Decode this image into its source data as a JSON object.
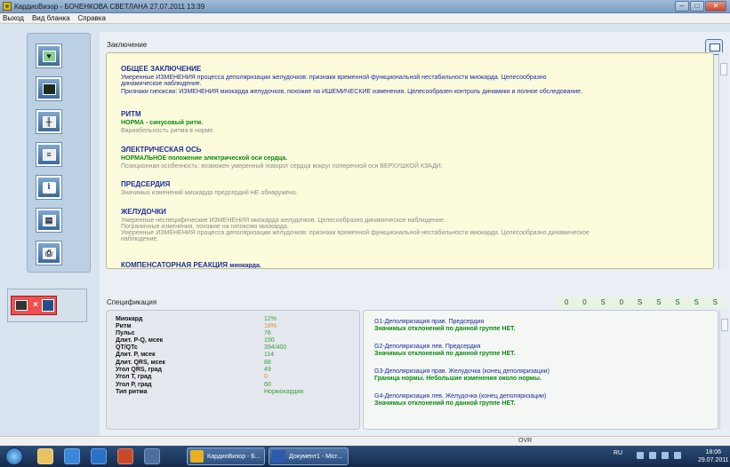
{
  "window": {
    "title": "КардиоВизор - БОЧЕНКОВА  СВЕТЛАНА   27.07.2011  13:39",
    "min_glyph": "–",
    "max_glyph": "□",
    "close_glyph": "✕"
  },
  "menu": [
    "Выход",
    "Вид бланка",
    "Справка"
  ],
  "left_toolbar": {
    "buttons": [
      {
        "icon": "heart-monitor-icon",
        "glyph": "♥"
      },
      {
        "icon": "dark-screen-icon",
        "glyph": ""
      },
      {
        "icon": "ecg-graph-icon",
        "glyph": "╫"
      },
      {
        "icon": "ecg-sheet-icon",
        "glyph": "≡"
      },
      {
        "icon": "info-icon",
        "glyph": "i"
      },
      {
        "icon": "print-stack-icon",
        "glyph": "▤"
      },
      {
        "icon": "printer-icon",
        "glyph": "⎙"
      }
    ]
  },
  "conclusion": {
    "header": "Заключение",
    "general": {
      "title": "ОБЩЕЕ ЗАКЛЮЧЕНИЕ",
      "line1": "Умеренные ИЗМЕНЕНИЯ процесса  деполяризации желудочков:  признаки  временной функциональной нестабильности миокарда.  Целесообразно",
      "line2": "динамическое наблюдение.",
      "line3": "Признаки гипоксии: ИЗМЕНЕНИЯ миокарда желудочков, похожие на ИШЕМИЧЕСКИЕ изменения. Целесообразен контроль динамики и полное обследование."
    },
    "rhythm": {
      "title": "РИТМ",
      "status": "НОРМА - синусовый ритм.",
      "detail": "Вариабельность ритма в норме."
    },
    "axis": {
      "title": "ЭЛЕКТРИЧЕСКАЯ ОСЬ",
      "status": "НОРМАЛЬНОЕ положение электрической оси сердца.",
      "detail": "Позиционная особенность: возможен умеренный поворот сердца вокруг поперечной оси ВЕРХУШКОЙ КЗАДИ."
    },
    "atria": {
      "title": "ПРЕДСЕРДИЯ",
      "detail": "Значимых  изменений  миокарда предсердий НЕ обнаружено."
    },
    "ventricles": {
      "title": "ЖЕЛУДОЧКИ",
      "line1": "Умеренные неспецифические ИЗМЕНЕНИЯ миокарда желудочков. Целесообразно динамическое наблюдение.",
      "line2": "Пограничные изменения, похожие на гипоксию миокарда.",
      "line3": "Умеренные ИЗМЕНЕНИЯ процесса  деполяризации желудочков:  признаки  временной  функциональной нестабильности миокарда.  Целесообразно  динамическое",
      "line4": "наблюдение."
    },
    "compensatory": {
      "title": "КОМПЕНСАТОРНАЯ РЕАКЦИЯ",
      "suffix": "миокарда."
    }
  },
  "specification": {
    "header": "Спецификация",
    "codes": [
      "0",
      "0",
      "S",
      "0",
      "S",
      "S",
      "S",
      "S",
      "S"
    ],
    "parameters": [
      {
        "label": "Миокард",
        "value": "12%",
        "color": "#3aa03a"
      },
      {
        "label": "Ритм",
        "value": "18%",
        "color": "#d99030"
      },
      {
        "label": "Пульс",
        "value": "76",
        "color": "#3aa03a"
      },
      {
        "label": "Длит. P-Q, мсек",
        "value": "150",
        "color": "#3aa03a"
      },
      {
        "label": "QT/QTc",
        "value": "394/400",
        "color": "#3aa03a"
      },
      {
        "label": "Длит. P, мсек",
        "value": "114",
        "color": "#3aa03a"
      },
      {
        "label": "Длит. QRS, мсек",
        "value": "88",
        "color": "#3aa03a"
      },
      {
        "label": "Угол QRS, град",
        "value": "49",
        "color": "#3aa03a"
      },
      {
        "label": "Угол T, град",
        "value": "0",
        "color": "#d99030"
      },
      {
        "label": "Угол P, град",
        "value": "60",
        "color": "#3aa03a"
      },
      {
        "label": "Тип ритма",
        "value": "Нормокардия",
        "color": "#3aa03a"
      }
    ],
    "groups": [
      {
        "title": "G1-Деполяризация  прав.  Предсердия",
        "status": "Значимых  отклонений  по данной  группе  НЕТ."
      },
      {
        "title": "G2-Деполяризация  лев. Предсердия",
        "status": "Значимых  отклонений  по данной  группе  НЕТ."
      },
      {
        "title": "G3-Деполяризация  прав. Желудочка (конец  деполяризации)",
        "status": "Граница нормы. Небольшие изменения около нормы."
      },
      {
        "title": "G4-Деполяризация  лев. Желудочка  (конец  деполяризации)",
        "status": "Значимых  отклонений  по данной  группе  НЕТ."
      }
    ]
  },
  "status_bar": {
    "ovr": "OVR"
  },
  "taskbar": {
    "tasks": [
      {
        "label": "КардиоВизор - Б..."
      },
      {
        "label": "Документ1 - Micr..."
      }
    ],
    "tray_lang": "RU",
    "time": "18:06",
    "date": "29.07.2011"
  },
  "colors": {
    "accent_blue": "#1d2e9c",
    "status_green": "#0a8a12",
    "muted_grey": "#8c8c8c",
    "conclusion_bg": "#fcfbdc",
    "connection_alert": "#f05050"
  }
}
